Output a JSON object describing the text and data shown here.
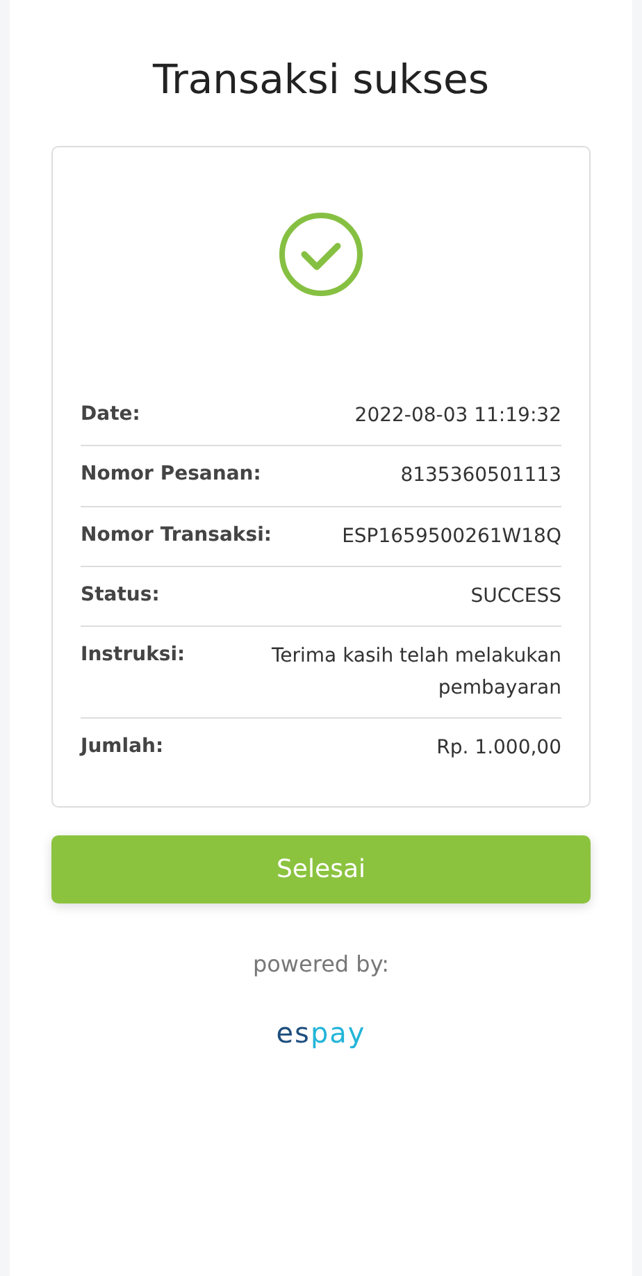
{
  "title": "Transaksi sukses",
  "details": [
    {
      "label": "Date:",
      "value": "2022-08-03 11:19:32"
    },
    {
      "label": "Nomor Pesanan:",
      "value": "8135360501113"
    },
    {
      "label": "Nomor Transaksi:",
      "value": "ESP1659500261W18Q"
    },
    {
      "label": "Status:",
      "value": "SUCCESS"
    },
    {
      "label": "Instruksi:",
      "value": "Terima kasih telah melakukan pembayaran"
    },
    {
      "label": "Jumlah:",
      "value": "Rp. 1.000,00"
    }
  ],
  "button": "Selesai",
  "powered_by": "powered by:",
  "logo": [
    {
      "text": "es",
      "color": "#1d4e7e"
    },
    {
      "text": "pay",
      "color": "#22b5d8"
    }
  ]
}
